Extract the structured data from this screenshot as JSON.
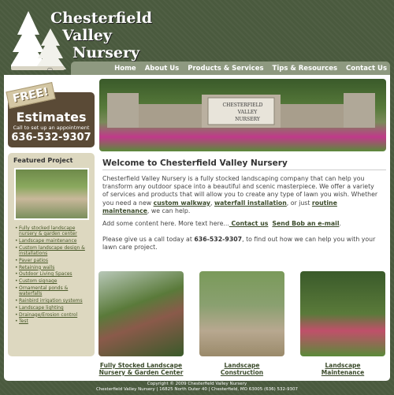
{
  "logo": {
    "line1": "Chesterfield",
    "line2": "Valley",
    "line3": "Nursery"
  },
  "nav": {
    "items": [
      "Home",
      "About Us",
      "Products & Services",
      "Tips & Resources",
      "Contact Us"
    ]
  },
  "promo": {
    "free": "FREE!",
    "title": "Estimates",
    "subtitle": "Call to set up an appointment",
    "phone": "636-532-9307"
  },
  "featured": {
    "heading": "Featured Project",
    "links": [
      "Fully stocked landscape nursery & garden center",
      "Landscape maintenance",
      "Custom landscape design & installations",
      "Paver patios",
      "Retaining walls",
      "Outdoor Living Spaces",
      "Custom signage",
      "Ornamental ponds & waterfalls",
      "Rainbird irrigation systems",
      "Landscape lighting",
      "Drainage/Erosion control",
      "Test"
    ]
  },
  "hero": {
    "sign_line1": "CHESTERFIELD",
    "sign_line2": "VALLEY",
    "sign_line3": "NURSERY"
  },
  "main": {
    "title": "Welcome to Chesterfield Valley Nursery",
    "p1_text": "Chesterfield Valley Nursery is a fully stocked landscaping company that can help you transform any outdoor space into a beautiful and scenic masterpiece. We offer a variety of services and products that will allow you to create any type of lawn you wish. Whether you need a new ",
    "p1_link1": "custom walkway",
    "p1_sep1": ", ",
    "p1_link2": "waterfall installation",
    "p1_sep2": ", or just ",
    "p1_link3": "routine maintenance",
    "p1_end": ", we can help.",
    "p2_text": "Add some content here. More text here...",
    "p2_link1": " Contact us",
    "p2_link2": "Send Bob an e-mail",
    "p2_end": ".",
    "p3_text": "Please give us a call today at ",
    "p3_phone": "636-532-9307",
    "p3_end": ", to find out how we can help you with your lawn care project."
  },
  "thumbs": [
    {
      "caption_line1": "Fully Stocked Landscape",
      "caption_line2": "Nursery & Garden Center"
    },
    {
      "caption_line1": "Landscape",
      "caption_line2": "Construction"
    },
    {
      "caption_line1": "Landscape",
      "caption_line2": "Maintenance"
    }
  ],
  "footer": {
    "copyright": "Copyright © 2009 Chesterfield Valley Nursery",
    "address": "Chesterfield Valley Nursery | 16825 North Outer 40 | Chesterfield, MO 63005 (636) 532-9307"
  }
}
